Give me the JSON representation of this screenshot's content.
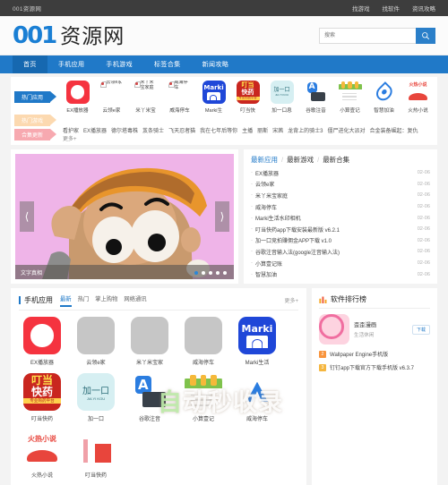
{
  "topbar": {
    "site": "001资源网",
    "links": [
      "找游戏",
      "找软件",
      "资讯攻略"
    ]
  },
  "header": {
    "logo_mark": "001",
    "logo_name": "资源网",
    "search_placeholder": "搜索",
    "search_value": "",
    "search_icon": "search-icon"
  },
  "nav": {
    "items": [
      {
        "label": "首页",
        "active": true
      },
      {
        "label": "手机应用",
        "active": false
      },
      {
        "label": "手机游戏",
        "active": false
      },
      {
        "label": "标签合集",
        "active": false
      },
      {
        "label": "新闻攻略",
        "active": false
      }
    ]
  },
  "promo": {
    "tags": {
      "apps": "热门应用",
      "games": "热门游戏",
      "collections": "合集更新"
    },
    "apps": [
      {
        "name": "EX播放器",
        "icon": "play-icon",
        "broken": false
      },
      {
        "name": "云领e家",
        "icon": "broken-image-icon",
        "broken": true,
        "alt": "云领e家"
      },
      {
        "name": "米丫米宝",
        "icon": "broken-image-icon",
        "broken": true,
        "alt": "米丫米宝家庭"
      },
      {
        "name": "威海停车",
        "icon": "broken-image-icon",
        "broken": true,
        "alt": "威海停车"
      },
      {
        "name": "Marki生",
        "icon": "marki-camera-icon",
        "broken": false
      },
      {
        "name": "叮当快",
        "icon": "pharmacy-icon",
        "broken": false
      },
      {
        "name": "加一口息",
        "icon": "jiayikou-icon",
        "broken": false
      },
      {
        "name": "谷歌注音",
        "icon": "keyboard-icon",
        "broken": false
      },
      {
        "name": "小算壹记",
        "icon": "notebook-icon",
        "broken": false
      },
      {
        "name": "智慧加油",
        "icon": "fuel-drop-icon",
        "broken": false
      },
      {
        "name": "火热小说",
        "icon": "novel-icon",
        "broken": false
      }
    ],
    "collection_tags": [
      "看护家",
      "EX播放器",
      "德尔塔毒株",
      "芨条骑士",
      "飞天忍者猫",
      "我在七年后等你",
      "主播",
      "丽斯",
      "宋茜",
      "龙背上的骑士3",
      "僵尸进化大派对",
      "合金装备崛起：复仇"
    ],
    "more_label": "更多+"
  },
  "slider": {
    "caption": "文字真相",
    "prev_icon": "chevron-left-icon",
    "next_icon": "chevron-right-icon",
    "dots": 5,
    "active_dot": 0
  },
  "latest": {
    "tabs": [
      "最新应用",
      "最新游戏",
      "最新合集"
    ],
    "active_tab": 0,
    "items": [
      {
        "title": "EX播放器",
        "date": "02-06"
      },
      {
        "title": "云领e家",
        "date": "02-06"
      },
      {
        "title": "米丫米宝家庭",
        "date": "02-06"
      },
      {
        "title": "威海停车",
        "date": "02-06"
      },
      {
        "title": "Marki生活水印相机",
        "date": "02-06"
      },
      {
        "title": "叮当快药app下载安装最新版 v6.2.1",
        "date": "02-06"
      },
      {
        "title": "加一口竞拍赚佣金APP下载 v1.0",
        "date": "02-06"
      },
      {
        "title": "谷歌注音输入法(google注音输入法)",
        "date": "02-06"
      },
      {
        "title": "小算壹记账",
        "date": "02-06"
      },
      {
        "title": "智慧加油",
        "date": "02-06"
      }
    ]
  },
  "apps_panel": {
    "title": "手机应用",
    "tabs": [
      {
        "label": "最新",
        "active": true
      },
      {
        "label": "热门",
        "active": false
      },
      {
        "label": "掌上购物",
        "active": false
      },
      {
        "label": "网络通讯",
        "active": false
      }
    ],
    "more_label": "更多+",
    "items": [
      {
        "name": "EX播放器",
        "icon": "play-icon"
      },
      {
        "name": "云领e家",
        "icon": "placeholder-icon"
      },
      {
        "name": "米丫米宝家",
        "icon": "placeholder-icon"
      },
      {
        "name": "威海停车",
        "icon": "placeholder-icon"
      },
      {
        "name": "Marki生活",
        "icon": "marki-camera-icon"
      },
      {
        "name": "叮当快药",
        "icon": "pharmacy-icon"
      },
      {
        "name": "加一口",
        "icon": "jiayikou-icon"
      },
      {
        "name": "谷歌注音",
        "icon": "keyboard-icon"
      },
      {
        "name": "小算壹记",
        "icon": "notebook-icon"
      },
      {
        "name": "威海停车",
        "icon": "wei-icon"
      },
      {
        "name": "火热小说",
        "icon": "novel-icon"
      },
      {
        "name": "叮当快药",
        "icon": "ding-icon"
      }
    ]
  },
  "rank_panel": {
    "title": "软件排行榜",
    "chart_icon": "bar-chart-icon",
    "featured": {
      "rank": "1",
      "title": "歪歪漫画",
      "category": "生活休闲",
      "download_label": "下载"
    },
    "items": [
      {
        "rank": "2",
        "title": "Wallpaper Engine手机版"
      },
      {
        "rank": "3",
        "title": "钉钉app下载官方下载手机版 v6.3.7"
      }
    ]
  },
  "watermark": {
    "text1": "自",
    "text2": "动秒收录"
  }
}
